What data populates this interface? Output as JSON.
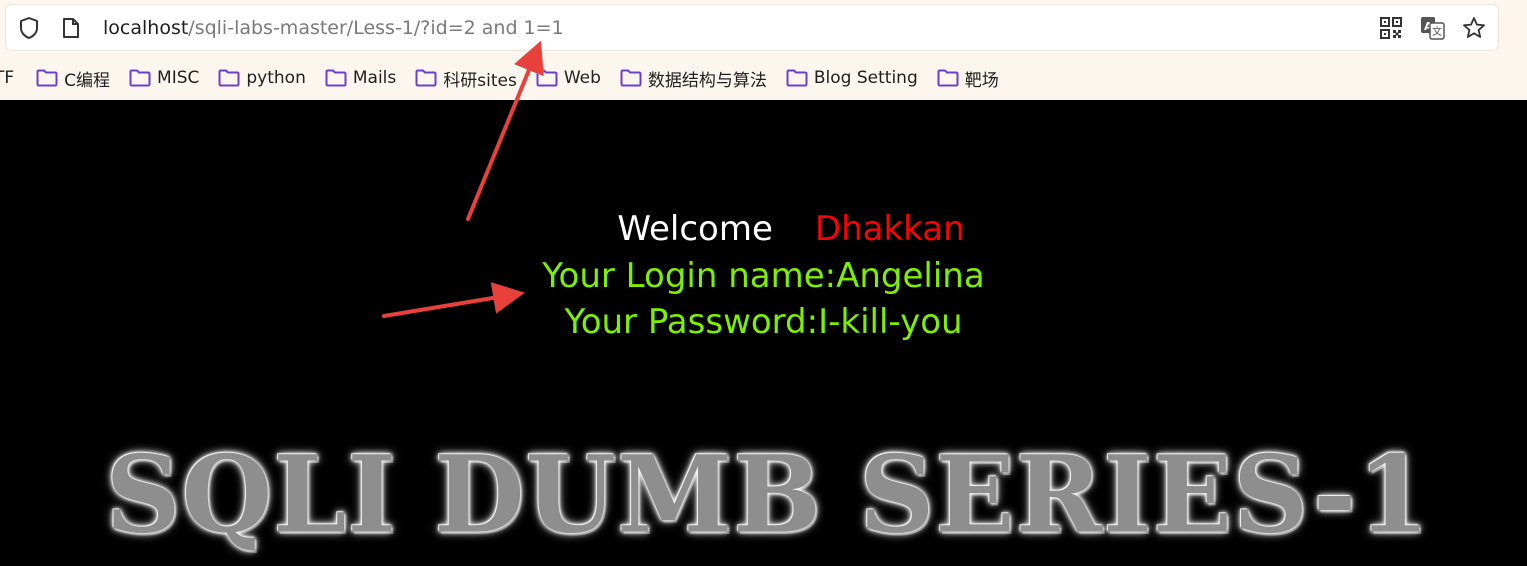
{
  "browser": {
    "url_host": "localhost",
    "url_path": "/sqli-labs-master/Less-1/?id=2 and 1=1",
    "icons": [
      "shield-icon",
      "page-icon",
      "qr-code-icon",
      "translate-icon",
      "star-icon"
    ]
  },
  "bookmarks": [
    {
      "label": "TF",
      "icon": "none"
    },
    {
      "label": "C编程",
      "icon": "folder-icon"
    },
    {
      "label": "MISC",
      "icon": "folder-icon"
    },
    {
      "label": "python",
      "icon": "folder-icon"
    },
    {
      "label": "Mails",
      "icon": "folder-icon"
    },
    {
      "label": "科研sites",
      "icon": "folder-icon"
    },
    {
      "label": "Web",
      "icon": "folder-icon"
    },
    {
      "label": "数据结构与算法",
      "icon": "folder-icon"
    },
    {
      "label": "Blog Setting",
      "icon": "folder-icon"
    },
    {
      "label": "靶场",
      "icon": "folder-icon"
    }
  ],
  "page": {
    "welcome_word": "Welcome",
    "user_name": "Dhakkan",
    "login_line": "Your Login name:Angelina",
    "password_line": "Your Password:I-kill-you",
    "banner_title": "SQLI DUMB SERIES-1"
  },
  "colors": {
    "accent_folder": "#6a3fd0",
    "login_text": "#7cf000",
    "user_name": "#ff0000",
    "annotation_arrow": "#e8413c"
  }
}
